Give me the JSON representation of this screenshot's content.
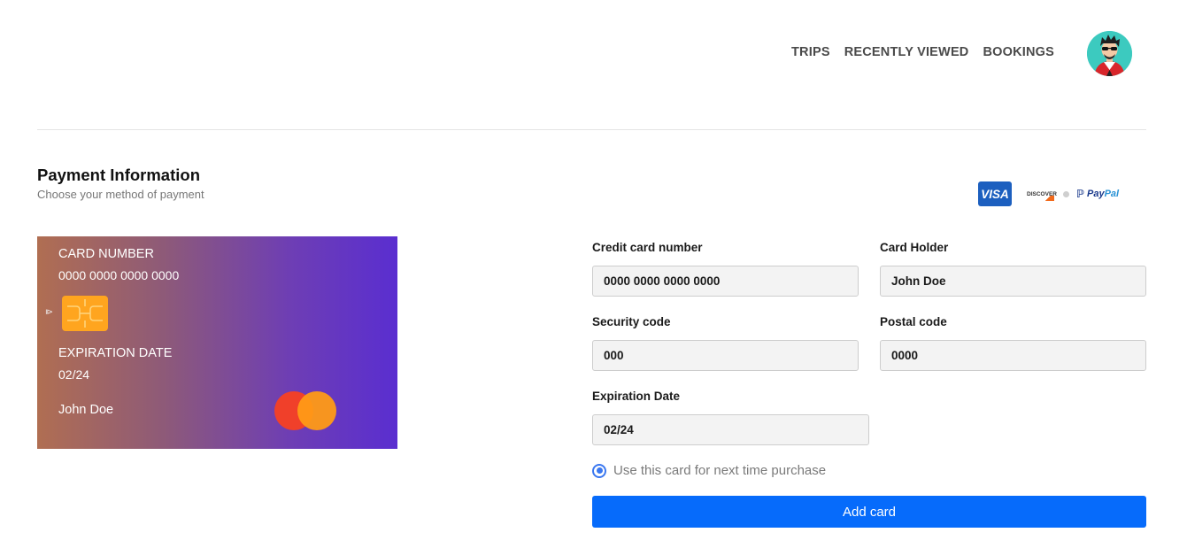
{
  "nav": {
    "items": [
      "TRIPS",
      "RECENTLY VIEWED",
      "BOOKINGS"
    ]
  },
  "payment": {
    "title": "Payment Information",
    "subtitle": "Choose your method of payment",
    "logos": {
      "visa": "VISA",
      "discover": "DISCOVER",
      "paypal_pay": "Pay",
      "paypal_pal": "Pal"
    }
  },
  "card_preview": {
    "number_label": "CARD NUMBER",
    "number": "0000 0000 0000 0000",
    "expiration_label": "EXPIRATION DATE",
    "expiration": "02/24",
    "holder": "John Doe"
  },
  "form": {
    "card_number_label": "Credit card number",
    "card_number_value": "0000 0000 0000 0000",
    "card_holder_label": "Card Holder",
    "card_holder_value": "John Doe",
    "security_code_label": "Security code",
    "security_code_value": "000",
    "postal_code_label": "Postal code",
    "postal_code_value": "0000",
    "expiration_label": "Expiration Date",
    "expiration_value": "02/24",
    "save_card_label": "Use this card for next time purchase",
    "submit_label": "Add card"
  },
  "colors": {
    "primary": "#066bfb",
    "radio": "#3b78f0",
    "chip": "#ffa51f"
  }
}
